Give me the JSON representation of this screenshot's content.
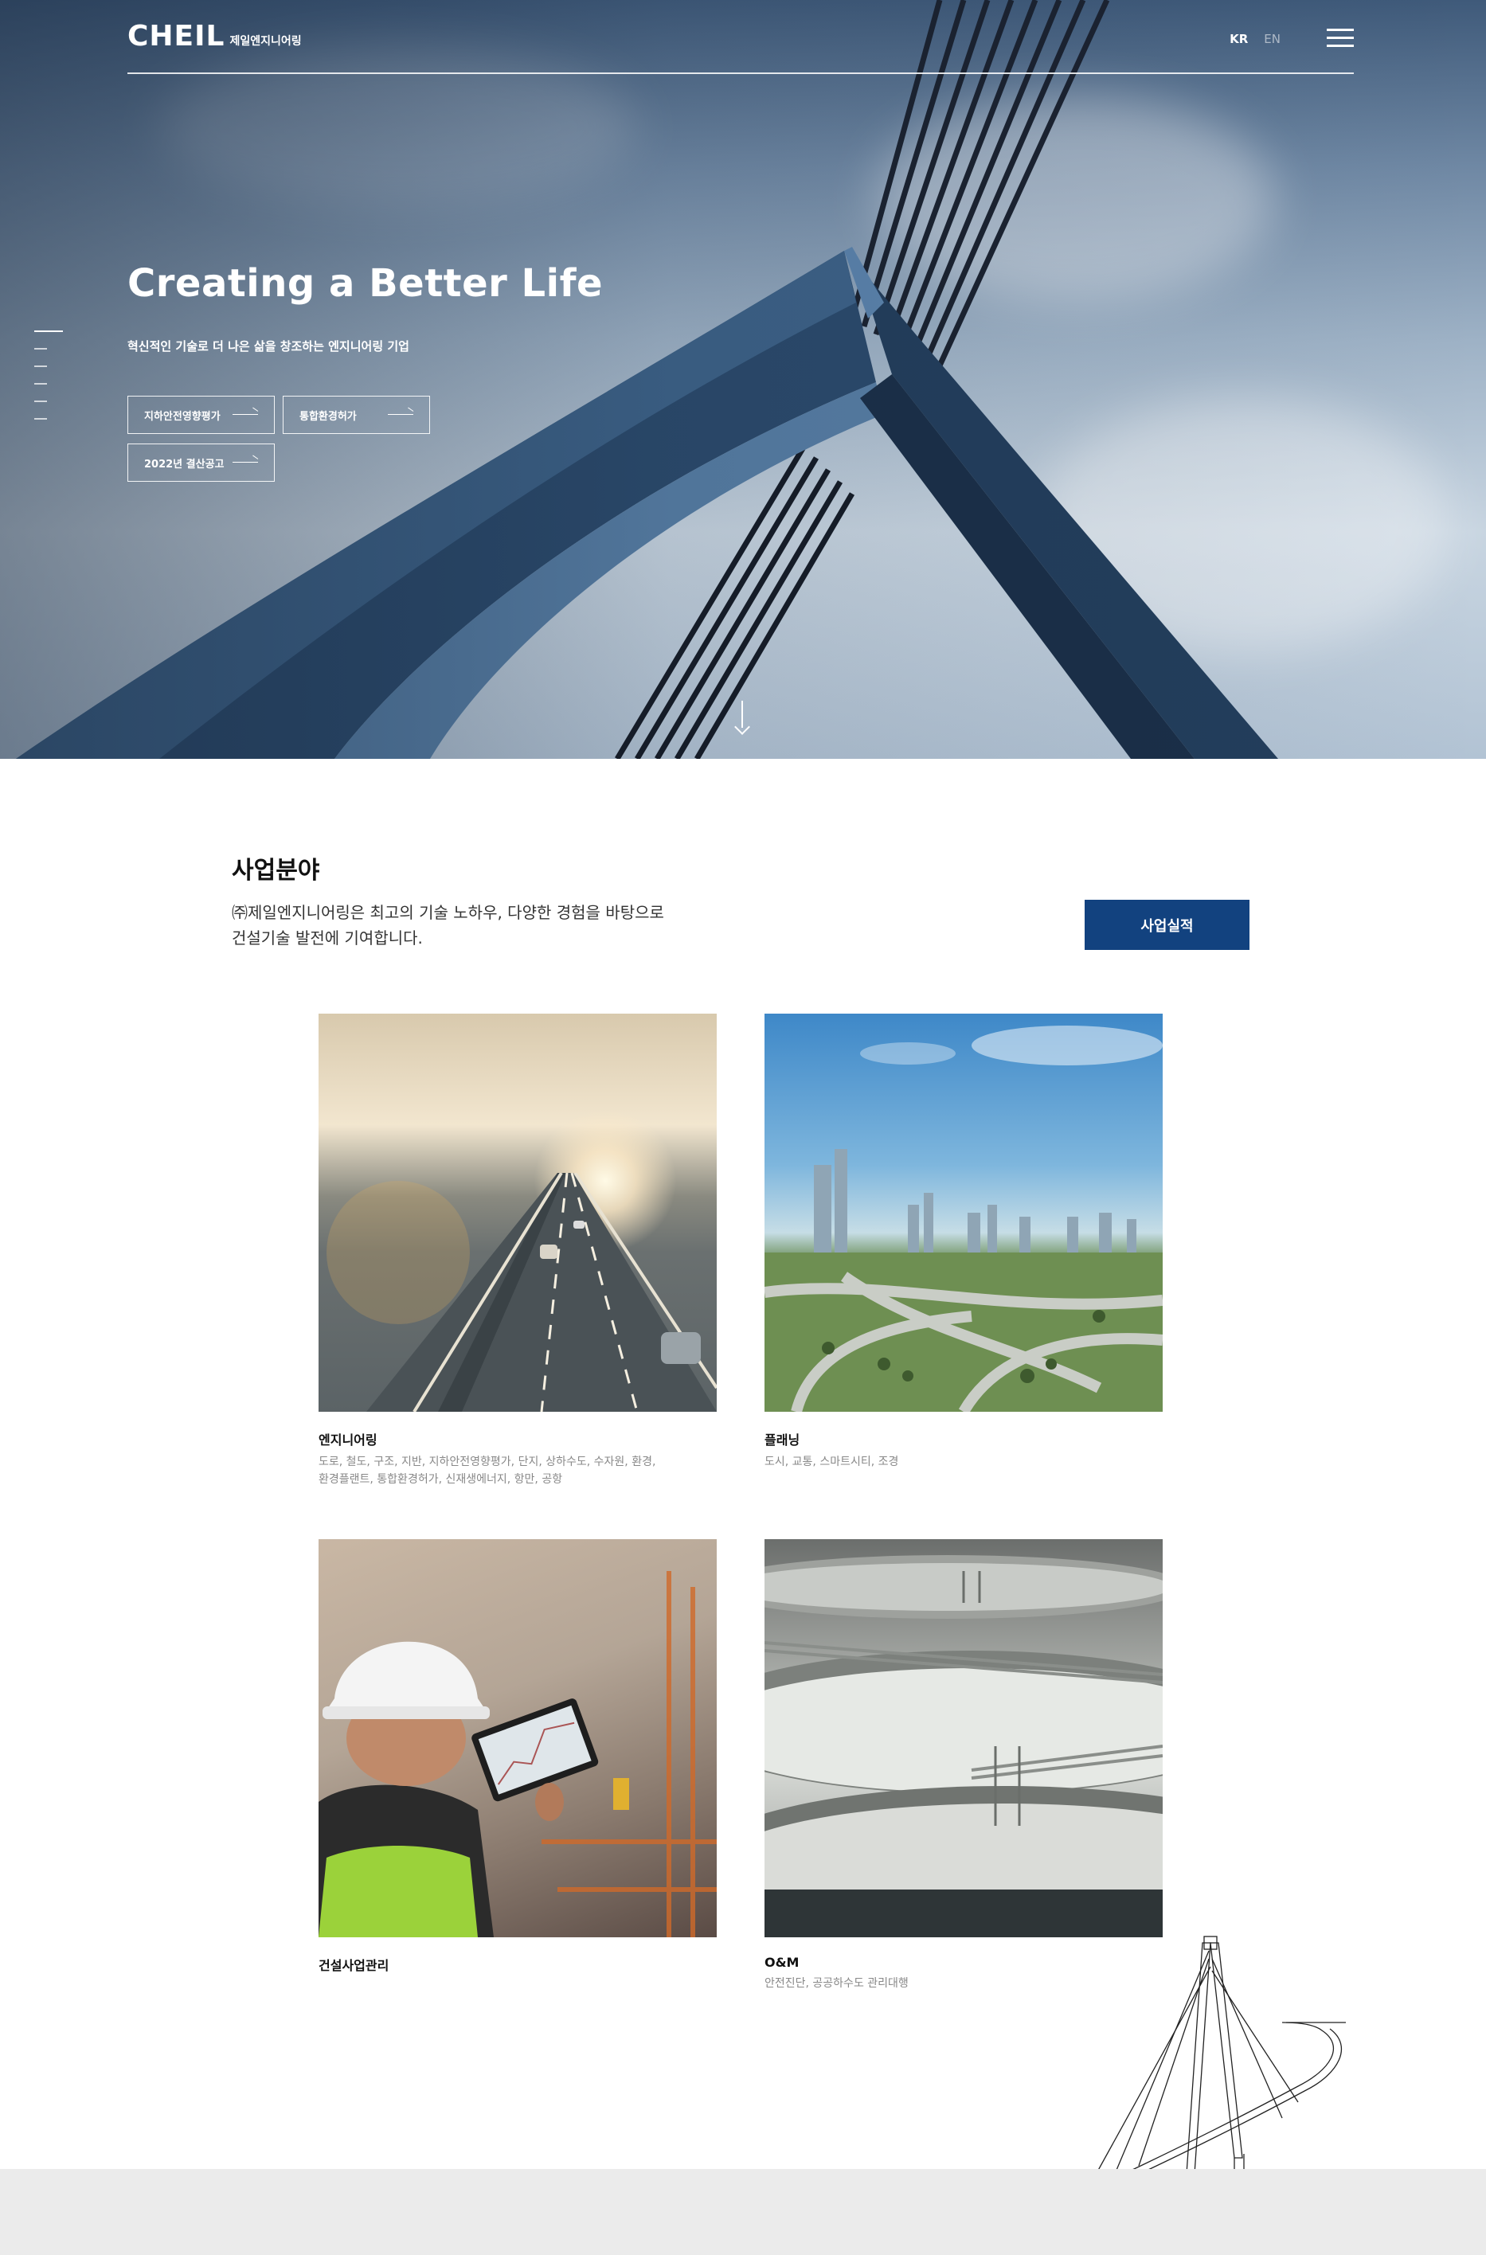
{
  "header": {
    "logo_mark": "CHEIL",
    "logo_sub": "제일엔지니어링",
    "lang_kr": "KR",
    "lang_en": "EN"
  },
  "hero": {
    "title": "Creating a Better Life",
    "subtitle": "혁신적인 기술로 더 나은 삶을 창조하는 엔지니어링 기업",
    "buttons": [
      {
        "label": "지하안전영향평가"
      },
      {
        "label": "통합환경허가"
      },
      {
        "label": "2022년 결산공고"
      }
    ]
  },
  "business": {
    "title": "사업분야",
    "desc_line1": "㈜제일엔지니어링은 최고의 기술 노하우, 다양한 경험을 바탕으로",
    "desc_line2": "건설기술 발전에 기여합니다.",
    "button": "사업실적",
    "cards": [
      {
        "name": "엔지니어링",
        "desc_line1": "도로, 철도, 구조, 지반, 지하안전영향평가, 단지, 상하수도, 수자원, 환경,",
        "desc_line2": "환경플랜트, 통합환경허가, 신재생에너지, 항만, 공항"
      },
      {
        "name": "플래닝",
        "desc_line1": "도시, 교통, 스마트시티, 조경",
        "desc_line2": ""
      },
      {
        "name": "건설사업관리",
        "desc_line1": "",
        "desc_line2": ""
      },
      {
        "name": "O&M",
        "desc_line1": "안전진단, 공공하수도 관리대행",
        "desc_line2": ""
      }
    ]
  },
  "colors": {
    "accent": "#12427f",
    "footer_band": "#ebebeb"
  }
}
